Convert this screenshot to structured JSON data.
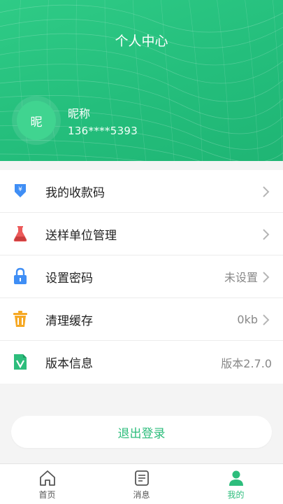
{
  "header": {
    "title": "个人中心",
    "avatar_text": "昵",
    "nickname": "昵称",
    "phone": "136****5393",
    "background_color": "#24be7c"
  },
  "menu": [
    {
      "label": "我的收款码",
      "value": "",
      "icon": "payment-code-icon",
      "chevron": true
    },
    {
      "label": "送样单位管理",
      "value": "",
      "icon": "flask-icon",
      "chevron": true
    },
    {
      "label": "设置密码",
      "value": "未设置",
      "icon": "lock-icon",
      "chevron": true
    },
    {
      "label": "清理缓存",
      "value": "0kb",
      "icon": "trash-icon",
      "chevron": true
    },
    {
      "label": "版本信息",
      "value": "版本2.7.0",
      "icon": "version-doc-icon",
      "chevron": false
    }
  ],
  "logout_label": "退出登录",
  "tabs": [
    {
      "label": "首页",
      "icon": "home-icon",
      "active": false
    },
    {
      "label": "消息",
      "icon": "message-icon",
      "active": false
    },
    {
      "label": "我的",
      "icon": "profile-icon",
      "active": true
    }
  ],
  "colors": {
    "accent": "#2dbd7c",
    "lock_blue": "#3f8ef5",
    "trash_orange": "#f6a823",
    "flask_red": "#ec5a5a"
  }
}
